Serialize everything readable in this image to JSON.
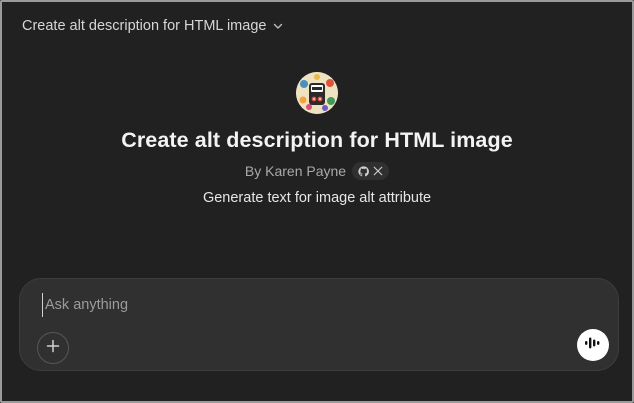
{
  "header": {
    "title": "Create alt description for HTML image",
    "dropdown_icon": "chevron-down-icon"
  },
  "gpt": {
    "logo_icon": "alt-tag-logo-icon",
    "title": "Create alt description for HTML image",
    "author": "By Karen Payne",
    "social_icons": [
      "github-icon",
      "x-icon"
    ],
    "description": "Generate text for image alt attribute"
  },
  "composer": {
    "placeholder": "Ask anything",
    "attach_icon": "plus-icon",
    "voice_icon": "voice-mode-icon"
  }
}
